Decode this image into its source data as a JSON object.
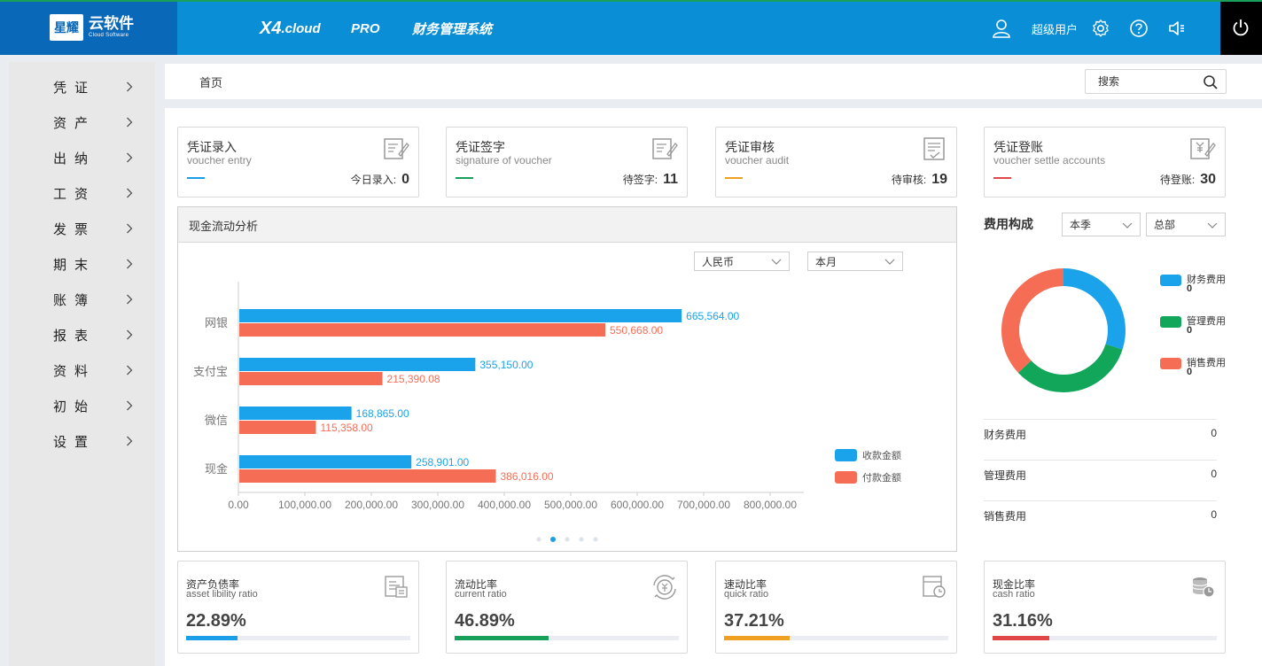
{
  "header": {
    "logo_badge": "星耀",
    "logo_name": "云软件",
    "logo_sub": "Cloud Software",
    "product_x4": "X4",
    "product_cloud": ".cloud",
    "product_pro": "PRO",
    "product_system": "财务管理系统",
    "user_label": "超级用户"
  },
  "sidebar": {
    "items": [
      {
        "label": "凭证"
      },
      {
        "label": "资产"
      },
      {
        "label": "出纳"
      },
      {
        "label": "工资"
      },
      {
        "label": "发票"
      },
      {
        "label": "期末"
      },
      {
        "label": "账簿"
      },
      {
        "label": "报表"
      },
      {
        "label": "资料"
      },
      {
        "label": "初始"
      },
      {
        "label": "设置"
      }
    ]
  },
  "breadcrumb": {
    "home": "首页"
  },
  "search": {
    "placeholder": "搜索"
  },
  "cards": [
    {
      "title": "凭证录入",
      "subtitle": "voucher entry",
      "count_label": "今日录入:",
      "count": "0",
      "color": "#1a9ee8"
    },
    {
      "title": "凭证签字",
      "subtitle": "signature of voucher",
      "count_label": "待签字:",
      "count": "11",
      "color": "#16a05a"
    },
    {
      "title": "凭证审核",
      "subtitle": "voucher audit",
      "count_label": "待审核:",
      "count": "19",
      "color": "#f0a020"
    },
    {
      "title": "凭证登账",
      "subtitle": "voucher settle accounts",
      "count_label": "待登账:",
      "count": "30",
      "color": "#e04848"
    }
  ],
  "cash_panel": {
    "title": "现金流动分析",
    "currency_select": "人民币",
    "period_select": "本月"
  },
  "chart_data": {
    "type": "bar",
    "orientation": "horizontal",
    "categories": [
      "网银",
      "支付宝",
      "微信",
      "现金"
    ],
    "series": [
      {
        "name": "收款金额",
        "color": "#1aa3ea",
        "values": [
          665564.0,
          355150.0,
          168865.0,
          258901.0
        ],
        "labels": [
          "665,564.00",
          "355,150.00",
          "168,865.00",
          "258,901.00"
        ]
      },
      {
        "name": "付款金额",
        "color": "#f56d55",
        "values": [
          550668.0,
          215390.08,
          115358.0,
          386016.0
        ],
        "labels": [
          "550,668.00",
          "215,390.08",
          "115,358.00",
          "386,016.00"
        ]
      }
    ],
    "xlim": [
      0,
      800000
    ],
    "ticks": [
      0,
      100000,
      200000,
      300000,
      400000,
      500000,
      600000,
      700000,
      800000
    ],
    "tick_labels": [
      "0.00",
      "100,000.00",
      "200,000.00",
      "300,000.00",
      "400,000.00",
      "500,000.00",
      "600,000.00",
      "700,000.00",
      "800,000.00"
    ],
    "legend_position": "right",
    "grid": false,
    "page_dots": 5,
    "active_dot": 1
  },
  "fee": {
    "title": "费用构成",
    "season_select": "本季",
    "dept_select": "总部",
    "legend": [
      {
        "name": "财务费用",
        "value": "0",
        "color": "#1aa3ea"
      },
      {
        "name": "管理费用",
        "value": "0",
        "color": "#11a65a"
      },
      {
        "name": "销售费用",
        "value": "0",
        "color": "#f56d55"
      }
    ],
    "donut_shares": [
      0.3,
      0.33,
      0.37
    ],
    "rows": [
      {
        "name": "财务费用",
        "value": "0"
      },
      {
        "name": "管理费用",
        "value": "0"
      },
      {
        "name": "销售费用",
        "value": "0"
      }
    ]
  },
  "ratios": [
    {
      "title": "资产负债率",
      "subtitle": "asset libility ratio",
      "value": "22.89%",
      "fraction": 0.2289,
      "color": "#1a9ee8"
    },
    {
      "title": "流动比率",
      "subtitle": "current ratio",
      "value": "46.89%",
      "fraction": 0.4189,
      "color": "#16a05a"
    },
    {
      "title": "速动比率",
      "subtitle": "quick ratio",
      "value": "37.21%",
      "fraction": 0.2921,
      "color": "#f0a020"
    },
    {
      "title": "现金比率",
      "subtitle": "cash ratio",
      "value": "31.16%",
      "fraction": 0.2516,
      "color": "#e04848"
    }
  ]
}
